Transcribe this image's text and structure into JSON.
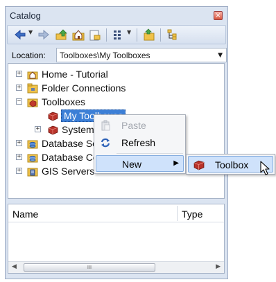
{
  "window": {
    "title": "Catalog",
    "close_glyph": "×"
  },
  "toolbar": {
    "icons": [
      "back-icon",
      "forward-icon",
      "up-one-level-icon",
      "home-folder-icon",
      "connect-folder-icon",
      "toggle-contents-icon",
      "add-geodatabase-icon",
      "tree-icon"
    ]
  },
  "location": {
    "label": "Location:",
    "value": "Toolboxes\\My Toolboxes"
  },
  "tree": {
    "items": [
      {
        "label": "Home - Tutorial",
        "expander": "+"
      },
      {
        "label": "Folder Connections",
        "expander": "+"
      },
      {
        "label": "Toolboxes",
        "expander": "−"
      },
      {
        "label": "My Toolboxes",
        "selected": true
      },
      {
        "label": "System Toolboxes",
        "expander": "+"
      },
      {
        "label": "Database Servers",
        "expander": "+"
      },
      {
        "label": "Database Connections",
        "expander": "+"
      },
      {
        "label": "GIS Servers",
        "expander": "+"
      }
    ]
  },
  "grid": {
    "columns": [
      "Name",
      "Type"
    ],
    "scroll_thumb": "III"
  },
  "context_menu": {
    "items": [
      {
        "label": "Paste",
        "icon": "paste-icon",
        "enabled": false
      },
      {
        "label": "Refresh",
        "icon": "refresh-icon",
        "enabled": true
      },
      {
        "label": "New",
        "icon": "",
        "enabled": true,
        "highlighted": true,
        "submenu_arrow": "▶"
      }
    ]
  },
  "submenu": {
    "items": [
      {
        "label": "Toolbox",
        "icon": "toolbox-icon",
        "highlighted": true
      }
    ]
  },
  "colors": {
    "panel_bg": "#dbe4f1",
    "selection": "#3c7fd6",
    "menu_highlight": "#cfe2fb",
    "toolbox_red": "#b8322a"
  }
}
